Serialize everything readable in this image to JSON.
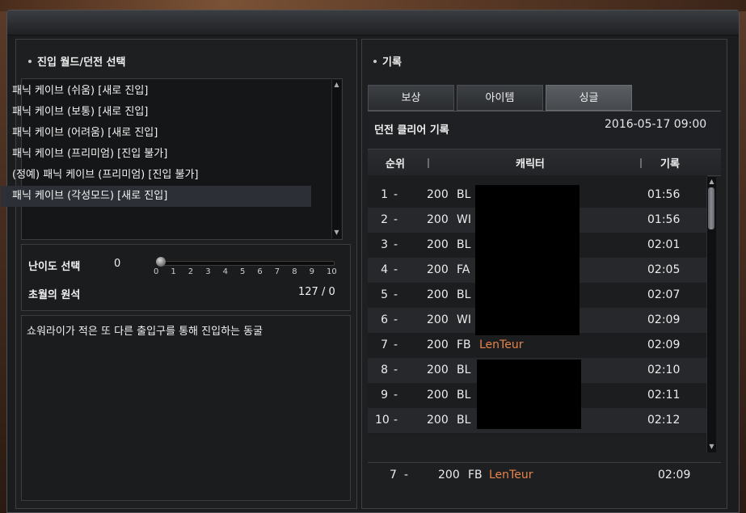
{
  "left_panel": {
    "title": "진입 월드/던전 선택",
    "dungeons": [
      {
        "label": "패닉 케이브 (쉬움) [새로 진입]",
        "selected": false
      },
      {
        "label": "패닉 케이브 (보통) [새로 진입]",
        "selected": false
      },
      {
        "label": "패닉 케이브 (어려움) [새로 진입]",
        "selected": false
      },
      {
        "label": "패닉 케이브 (프리미엄) [진입 불가]",
        "selected": false
      },
      {
        "label": "(정예) 패닉 케이브 (프리미엄) [진입 불가]",
        "selected": false
      },
      {
        "label": "패닉 케이브 (각성모드) [새로 진입]",
        "selected": true
      }
    ],
    "difficulty": {
      "label": "난이도 선택",
      "value": "0",
      "ticks": [
        "0",
        "1",
        "2",
        "3",
        "4",
        "5",
        "6",
        "7",
        "8",
        "9",
        "10"
      ],
      "level": 0,
      "max": 10
    },
    "stone": {
      "label": "초월의 원석",
      "value": "127 / 0"
    },
    "description": "쇼워라이가 적은 또 다른 출입구를 통해 진입하는 동굴"
  },
  "right_panel": {
    "title": "기록",
    "tabs": [
      {
        "label": "보상",
        "active": false
      },
      {
        "label": "아이템",
        "active": false
      },
      {
        "label": "싱글",
        "active": true
      }
    ],
    "record_title": "던전 클리어 기록",
    "record_date": "2016-05-17 09:00",
    "columns": {
      "rank": "순위",
      "character": "캐릭터",
      "record": "기록"
    },
    "rows": [
      {
        "rank": "1",
        "change": "-",
        "level": "200",
        "cls": "BL",
        "name": "",
        "time": "01:56"
      },
      {
        "rank": "2",
        "change": "-",
        "level": "200",
        "cls": "WI",
        "name": "",
        "time": "01:56"
      },
      {
        "rank": "3",
        "change": "-",
        "level": "200",
        "cls": "BL",
        "name": "",
        "time": "02:01"
      },
      {
        "rank": "4",
        "change": "-",
        "level": "200",
        "cls": "FA",
        "name": "",
        "time": "02:05"
      },
      {
        "rank": "5",
        "change": "-",
        "level": "200",
        "cls": "BL",
        "name": "",
        "time": "02:07"
      },
      {
        "rank": "6",
        "change": "-",
        "level": "200",
        "cls": "WI",
        "name": "",
        "time": "02:09"
      },
      {
        "rank": "7",
        "change": "-",
        "level": "200",
        "cls": "FB",
        "name": "LenTeur",
        "time": "02:09"
      },
      {
        "rank": "8",
        "change": "-",
        "level": "200",
        "cls": "BL",
        "name": "",
        "time": "02:10"
      },
      {
        "rank": "9",
        "change": "-",
        "level": "200",
        "cls": "BL",
        "name": "",
        "time": "02:11"
      },
      {
        "rank": "10",
        "change": "-",
        "level": "200",
        "cls": "BL",
        "name": "",
        "time": "02:12"
      }
    ],
    "my_record": {
      "rank": "7",
      "change": "-",
      "level": "200",
      "cls": "FB",
      "name": "LenTeur",
      "time": "02:09"
    }
  },
  "colors": {
    "highlight_name": "#e8834a",
    "selected_row": "#2c3036"
  }
}
